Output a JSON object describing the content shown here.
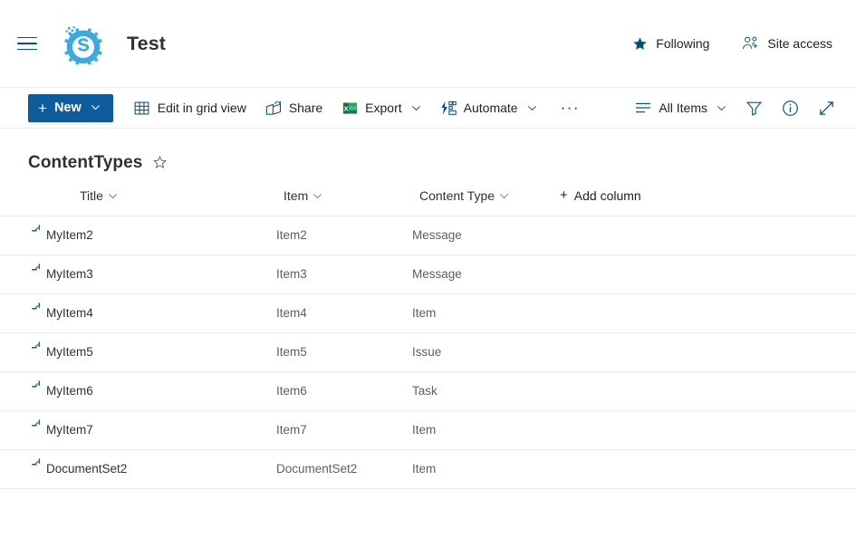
{
  "header": {
    "menu_icon": "hamburger-menu-icon",
    "logo_icon": "site-gear-logo-icon",
    "site_title": "Test",
    "following_label": "Following",
    "following_icon": "star-filled-icon",
    "site_access_label": "Site access",
    "site_access_icon": "people-add-icon"
  },
  "command_bar": {
    "new_label": "New",
    "new_plus": "+",
    "new_chevron": "chevron-down-icon",
    "items": [
      {
        "label": "Edit in grid view",
        "icon": "grid-table-icon",
        "chevron": false
      },
      {
        "label": "Share",
        "icon": "share-icon",
        "chevron": false
      },
      {
        "label": "Export",
        "icon": "excel-icon",
        "chevron": true
      },
      {
        "label": "Automate",
        "icon": "automate-flow-icon",
        "chevron": true
      }
    ],
    "overflow_label": "···",
    "view_label": "All Items",
    "view_icon": "list-view-icon",
    "view_chevron": "chevron-down-icon",
    "filter_icon": "filter-funnel-icon",
    "info_icon": "info-circle-icon",
    "expand_icon": "expand-diagonal-icon"
  },
  "list": {
    "title": "ContentTypes",
    "favorite_icon": "star-outline-icon",
    "columns": [
      {
        "label": "Title",
        "chevron": "chevron-down-icon"
      },
      {
        "label": "Item",
        "chevron": "chevron-down-icon"
      },
      {
        "label": "Content Type",
        "chevron": "chevron-down-icon"
      }
    ],
    "add_column_label": "Add column",
    "add_column_plus": "+",
    "rows": [
      {
        "title": "MyItem2",
        "item": "Item2",
        "content_type": "Message"
      },
      {
        "title": "MyItem3",
        "item": "Item3",
        "content_type": "Message"
      },
      {
        "title": "MyItem4",
        "item": "Item4",
        "content_type": "Item"
      },
      {
        "title": "MyItem5",
        "item": "Item5",
        "content_type": "Issue"
      },
      {
        "title": "MyItem6",
        "item": "Item6",
        "content_type": "Task"
      },
      {
        "title": "MyItem7",
        "item": "Item7",
        "content_type": "Item"
      },
      {
        "title": "DocumentSet2",
        "item": "DocumentSet2",
        "content_type": "Item"
      }
    ],
    "row_glyph_icon": "loading-spinner-partial-icon"
  },
  "colors": {
    "brand_blue": "#0f5c9c",
    "logo_blue": "#3aaae1",
    "excel_green": "#1d7044",
    "link_text": "#323130",
    "secondary_text": "#605e5c",
    "divider": "#edebe9"
  }
}
